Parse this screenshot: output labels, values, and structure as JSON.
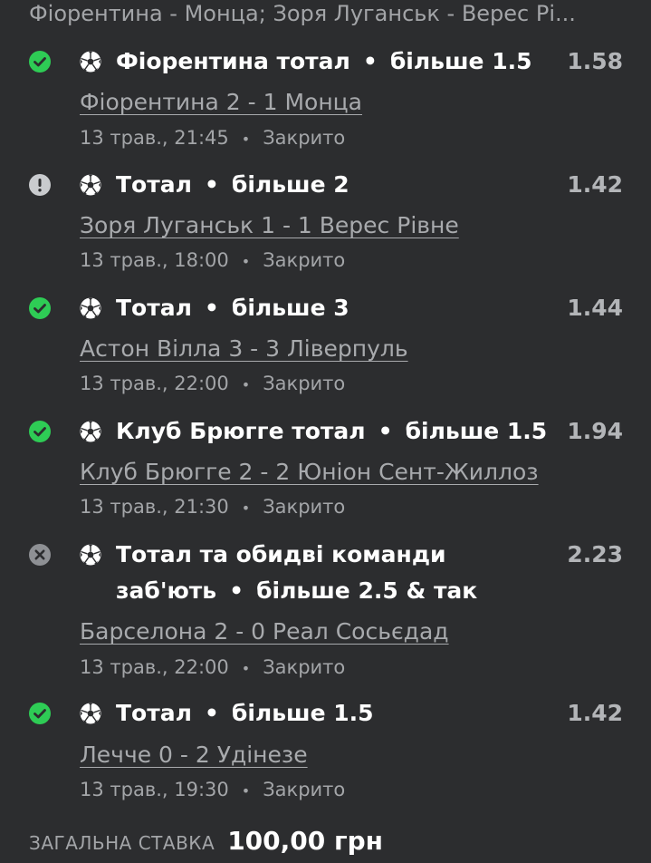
{
  "header": {
    "text": "Фіорентина - Монца; Зоря Луганськ - Верес Рі..."
  },
  "colors": {
    "background": "#2c2d2f",
    "won": "#2ecc55",
    "pending": "#c9cbce",
    "lost": "#8e9094",
    "odds": "#b3b5b8"
  },
  "bets": [
    {
      "status": "won",
      "status_icon": "check-circle-icon",
      "sport_icon": "soccer-ball-icon",
      "title_lines": [
        "Фіорентина тотал",
        "•",
        "більше 1.5"
      ],
      "market": "Фіорентина тотал",
      "selection": "більше 1.5",
      "odds": "1.58",
      "match": "Фіорентина 2 - 1 Монца",
      "date": "13 трав., 21:45",
      "state": "Закрито"
    },
    {
      "status": "pending",
      "status_icon": "exclamation-circle-icon",
      "sport_icon": "soccer-ball-icon",
      "market": "Тотал",
      "selection": "більше 2",
      "odds": "1.42",
      "match": "Зоря Луганськ 1 - 1 Верес Рівне",
      "date": "13 трав., 18:00",
      "state": "Закрито"
    },
    {
      "status": "won",
      "status_icon": "check-circle-icon",
      "sport_icon": "soccer-ball-icon",
      "market": "Тотал",
      "selection": "більше 3",
      "odds": "1.44",
      "match": "Астон Вілла 3 - 3 Ліверпуль",
      "date": "13 трав., 22:00",
      "state": "Закрито"
    },
    {
      "status": "won",
      "status_icon": "check-circle-icon",
      "sport_icon": "soccer-ball-icon",
      "market": "Клуб Брюгге тотал",
      "selection": "більше 1.5",
      "odds": "1.94",
      "match": "Клуб Брюгге 2 - 2 Юніон Сент-Жиллоз",
      "date": "13 трав., 21:30",
      "state": "Закрито"
    },
    {
      "status": "lost",
      "status_icon": "x-circle-icon",
      "sport_icon": "soccer-ball-icon",
      "market": "Тотал та обидві команди",
      "market_line2": "заб'ють",
      "selection": "більше 2.5 & так",
      "odds": "2.23",
      "match": "Барселона 2 - 0 Реал Сосьєдад",
      "date": "13 трав., 22:00",
      "state": "Закрито"
    },
    {
      "status": "won",
      "status_icon": "check-circle-icon",
      "sport_icon": "soccer-ball-icon",
      "market": "Тотал",
      "selection": "більше 1.5",
      "odds": "1.42",
      "match": "Лечче 0 - 2 Удінезе",
      "date": "13 трав., 19:30",
      "state": "Закрито"
    }
  ],
  "separator": "•",
  "total": {
    "label": "ЗАГАЛЬНА СТАВКА",
    "value": "100,00 грн"
  }
}
